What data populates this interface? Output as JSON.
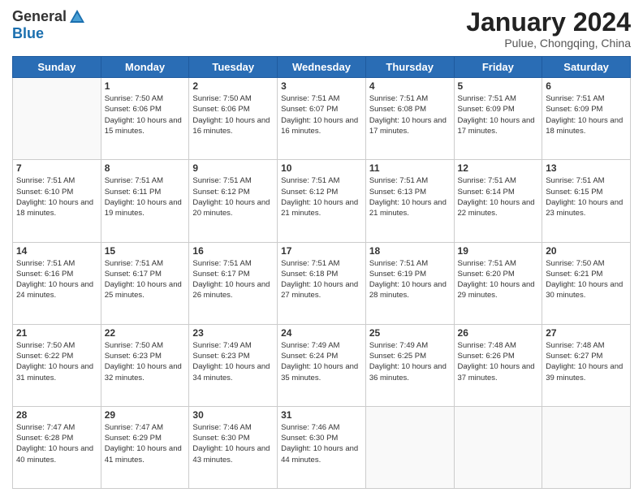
{
  "header": {
    "logo_general": "General",
    "logo_blue": "Blue",
    "month_year": "January 2024",
    "location": "Pulue, Chongqing, China"
  },
  "days_of_week": [
    "Sunday",
    "Monday",
    "Tuesday",
    "Wednesday",
    "Thursday",
    "Friday",
    "Saturday"
  ],
  "weeks": [
    [
      {
        "day": "",
        "sunrise": "",
        "sunset": "",
        "daylight": ""
      },
      {
        "day": "1",
        "sunrise": "Sunrise: 7:50 AM",
        "sunset": "Sunset: 6:06 PM",
        "daylight": "Daylight: 10 hours and 15 minutes."
      },
      {
        "day": "2",
        "sunrise": "Sunrise: 7:50 AM",
        "sunset": "Sunset: 6:06 PM",
        "daylight": "Daylight: 10 hours and 16 minutes."
      },
      {
        "day": "3",
        "sunrise": "Sunrise: 7:51 AM",
        "sunset": "Sunset: 6:07 PM",
        "daylight": "Daylight: 10 hours and 16 minutes."
      },
      {
        "day": "4",
        "sunrise": "Sunrise: 7:51 AM",
        "sunset": "Sunset: 6:08 PM",
        "daylight": "Daylight: 10 hours and 17 minutes."
      },
      {
        "day": "5",
        "sunrise": "Sunrise: 7:51 AM",
        "sunset": "Sunset: 6:09 PM",
        "daylight": "Daylight: 10 hours and 17 minutes."
      },
      {
        "day": "6",
        "sunrise": "Sunrise: 7:51 AM",
        "sunset": "Sunset: 6:09 PM",
        "daylight": "Daylight: 10 hours and 18 minutes."
      }
    ],
    [
      {
        "day": "7",
        "sunrise": "Sunrise: 7:51 AM",
        "sunset": "Sunset: 6:10 PM",
        "daylight": "Daylight: 10 hours and 18 minutes."
      },
      {
        "day": "8",
        "sunrise": "Sunrise: 7:51 AM",
        "sunset": "Sunset: 6:11 PM",
        "daylight": "Daylight: 10 hours and 19 minutes."
      },
      {
        "day": "9",
        "sunrise": "Sunrise: 7:51 AM",
        "sunset": "Sunset: 6:12 PM",
        "daylight": "Daylight: 10 hours and 20 minutes."
      },
      {
        "day": "10",
        "sunrise": "Sunrise: 7:51 AM",
        "sunset": "Sunset: 6:12 PM",
        "daylight": "Daylight: 10 hours and 21 minutes."
      },
      {
        "day": "11",
        "sunrise": "Sunrise: 7:51 AM",
        "sunset": "Sunset: 6:13 PM",
        "daylight": "Daylight: 10 hours and 21 minutes."
      },
      {
        "day": "12",
        "sunrise": "Sunrise: 7:51 AM",
        "sunset": "Sunset: 6:14 PM",
        "daylight": "Daylight: 10 hours and 22 minutes."
      },
      {
        "day": "13",
        "sunrise": "Sunrise: 7:51 AM",
        "sunset": "Sunset: 6:15 PM",
        "daylight": "Daylight: 10 hours and 23 minutes."
      }
    ],
    [
      {
        "day": "14",
        "sunrise": "Sunrise: 7:51 AM",
        "sunset": "Sunset: 6:16 PM",
        "daylight": "Daylight: 10 hours and 24 minutes."
      },
      {
        "day": "15",
        "sunrise": "Sunrise: 7:51 AM",
        "sunset": "Sunset: 6:17 PM",
        "daylight": "Daylight: 10 hours and 25 minutes."
      },
      {
        "day": "16",
        "sunrise": "Sunrise: 7:51 AM",
        "sunset": "Sunset: 6:17 PM",
        "daylight": "Daylight: 10 hours and 26 minutes."
      },
      {
        "day": "17",
        "sunrise": "Sunrise: 7:51 AM",
        "sunset": "Sunset: 6:18 PM",
        "daylight": "Daylight: 10 hours and 27 minutes."
      },
      {
        "day": "18",
        "sunrise": "Sunrise: 7:51 AM",
        "sunset": "Sunset: 6:19 PM",
        "daylight": "Daylight: 10 hours and 28 minutes."
      },
      {
        "day": "19",
        "sunrise": "Sunrise: 7:51 AM",
        "sunset": "Sunset: 6:20 PM",
        "daylight": "Daylight: 10 hours and 29 minutes."
      },
      {
        "day": "20",
        "sunrise": "Sunrise: 7:50 AM",
        "sunset": "Sunset: 6:21 PM",
        "daylight": "Daylight: 10 hours and 30 minutes."
      }
    ],
    [
      {
        "day": "21",
        "sunrise": "Sunrise: 7:50 AM",
        "sunset": "Sunset: 6:22 PM",
        "daylight": "Daylight: 10 hours and 31 minutes."
      },
      {
        "day": "22",
        "sunrise": "Sunrise: 7:50 AM",
        "sunset": "Sunset: 6:23 PM",
        "daylight": "Daylight: 10 hours and 32 minutes."
      },
      {
        "day": "23",
        "sunrise": "Sunrise: 7:49 AM",
        "sunset": "Sunset: 6:23 PM",
        "daylight": "Daylight: 10 hours and 34 minutes."
      },
      {
        "day": "24",
        "sunrise": "Sunrise: 7:49 AM",
        "sunset": "Sunset: 6:24 PM",
        "daylight": "Daylight: 10 hours and 35 minutes."
      },
      {
        "day": "25",
        "sunrise": "Sunrise: 7:49 AM",
        "sunset": "Sunset: 6:25 PM",
        "daylight": "Daylight: 10 hours and 36 minutes."
      },
      {
        "day": "26",
        "sunrise": "Sunrise: 7:48 AM",
        "sunset": "Sunset: 6:26 PM",
        "daylight": "Daylight: 10 hours and 37 minutes."
      },
      {
        "day": "27",
        "sunrise": "Sunrise: 7:48 AM",
        "sunset": "Sunset: 6:27 PM",
        "daylight": "Daylight: 10 hours and 39 minutes."
      }
    ],
    [
      {
        "day": "28",
        "sunrise": "Sunrise: 7:47 AM",
        "sunset": "Sunset: 6:28 PM",
        "daylight": "Daylight: 10 hours and 40 minutes."
      },
      {
        "day": "29",
        "sunrise": "Sunrise: 7:47 AM",
        "sunset": "Sunset: 6:29 PM",
        "daylight": "Daylight: 10 hours and 41 minutes."
      },
      {
        "day": "30",
        "sunrise": "Sunrise: 7:46 AM",
        "sunset": "Sunset: 6:30 PM",
        "daylight": "Daylight: 10 hours and 43 minutes."
      },
      {
        "day": "31",
        "sunrise": "Sunrise: 7:46 AM",
        "sunset": "Sunset: 6:30 PM",
        "daylight": "Daylight: 10 hours and 44 minutes."
      },
      {
        "day": "",
        "sunrise": "",
        "sunset": "",
        "daylight": ""
      },
      {
        "day": "",
        "sunrise": "",
        "sunset": "",
        "daylight": ""
      },
      {
        "day": "",
        "sunrise": "",
        "sunset": "",
        "daylight": ""
      }
    ]
  ]
}
